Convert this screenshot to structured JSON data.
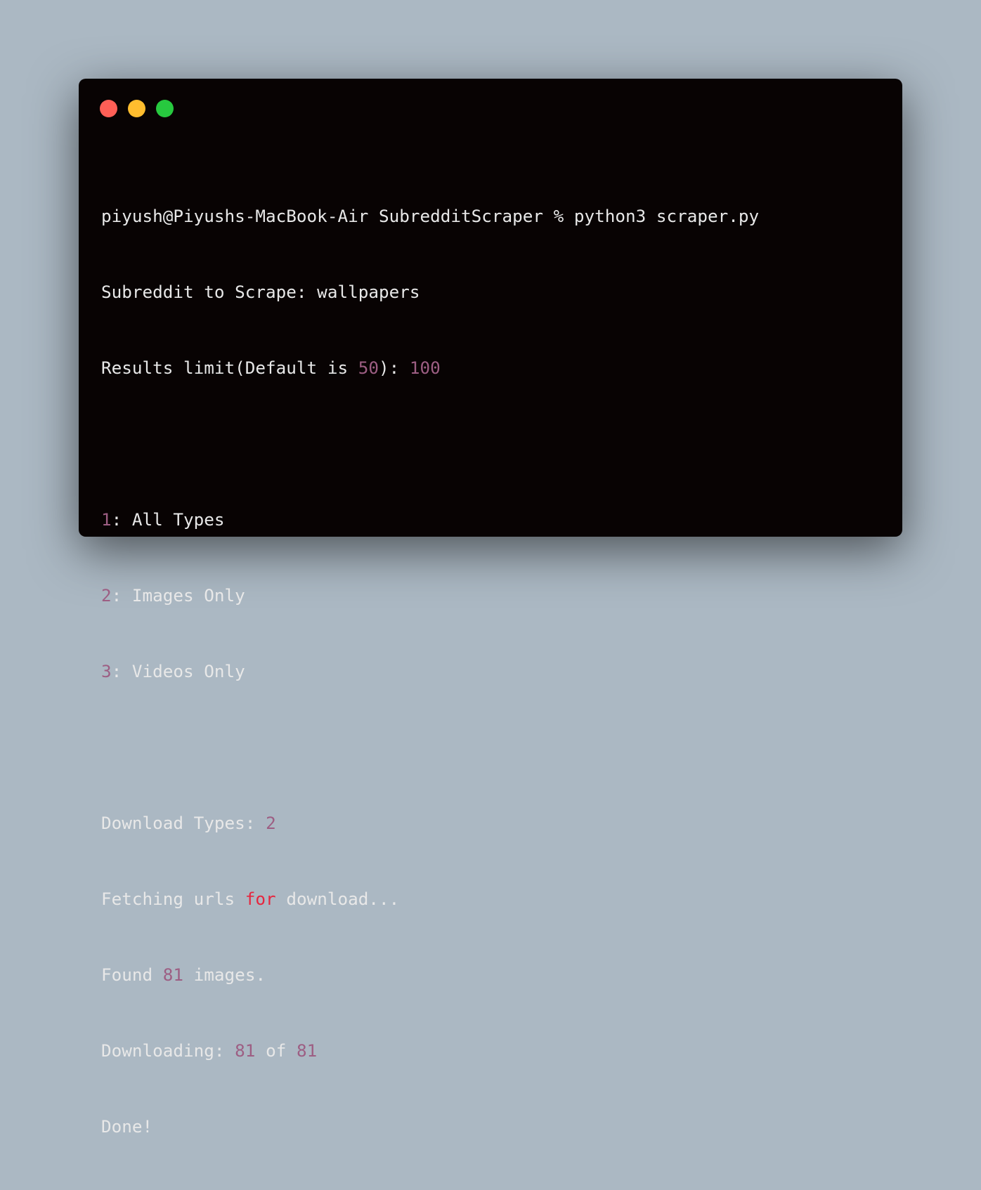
{
  "window": {
    "colors": {
      "background": "#080303",
      "page_background": "#abb8c3",
      "text": "#e8e8e8",
      "number": "#9d5e83",
      "keyword": "#e6263f",
      "close": "#ff5f56",
      "minimize": "#ffbd2e",
      "maximize": "#27c93f"
    }
  },
  "terminal": {
    "l1": {
      "text": "piyush@Piyushs-MacBook-Air SubredditScraper % python3 scraper.py"
    },
    "l2": {
      "text": "Subreddit to Scrape: wallpapers"
    },
    "l3": {
      "a": "Results limit(Default is ",
      "n1": "50",
      "b": "): ",
      "n2": "100"
    },
    "l5": {
      "n": "1",
      "t": ": All Types"
    },
    "l6": {
      "n": "2",
      "t": ": Images Only"
    },
    "l7": {
      "n": "3",
      "t": ": Videos Only"
    },
    "l9": {
      "t": "Download Types: ",
      "n": "2"
    },
    "l10": {
      "a": "Fetching urls ",
      "kw": "for",
      "b": " download..."
    },
    "l11": {
      "a": "Found ",
      "n": "81",
      "b": " images."
    },
    "l12": {
      "a": "Downloading: ",
      "n1": "81",
      "b": " of ",
      "n2": "81"
    },
    "l13": {
      "text": "Done!"
    }
  }
}
